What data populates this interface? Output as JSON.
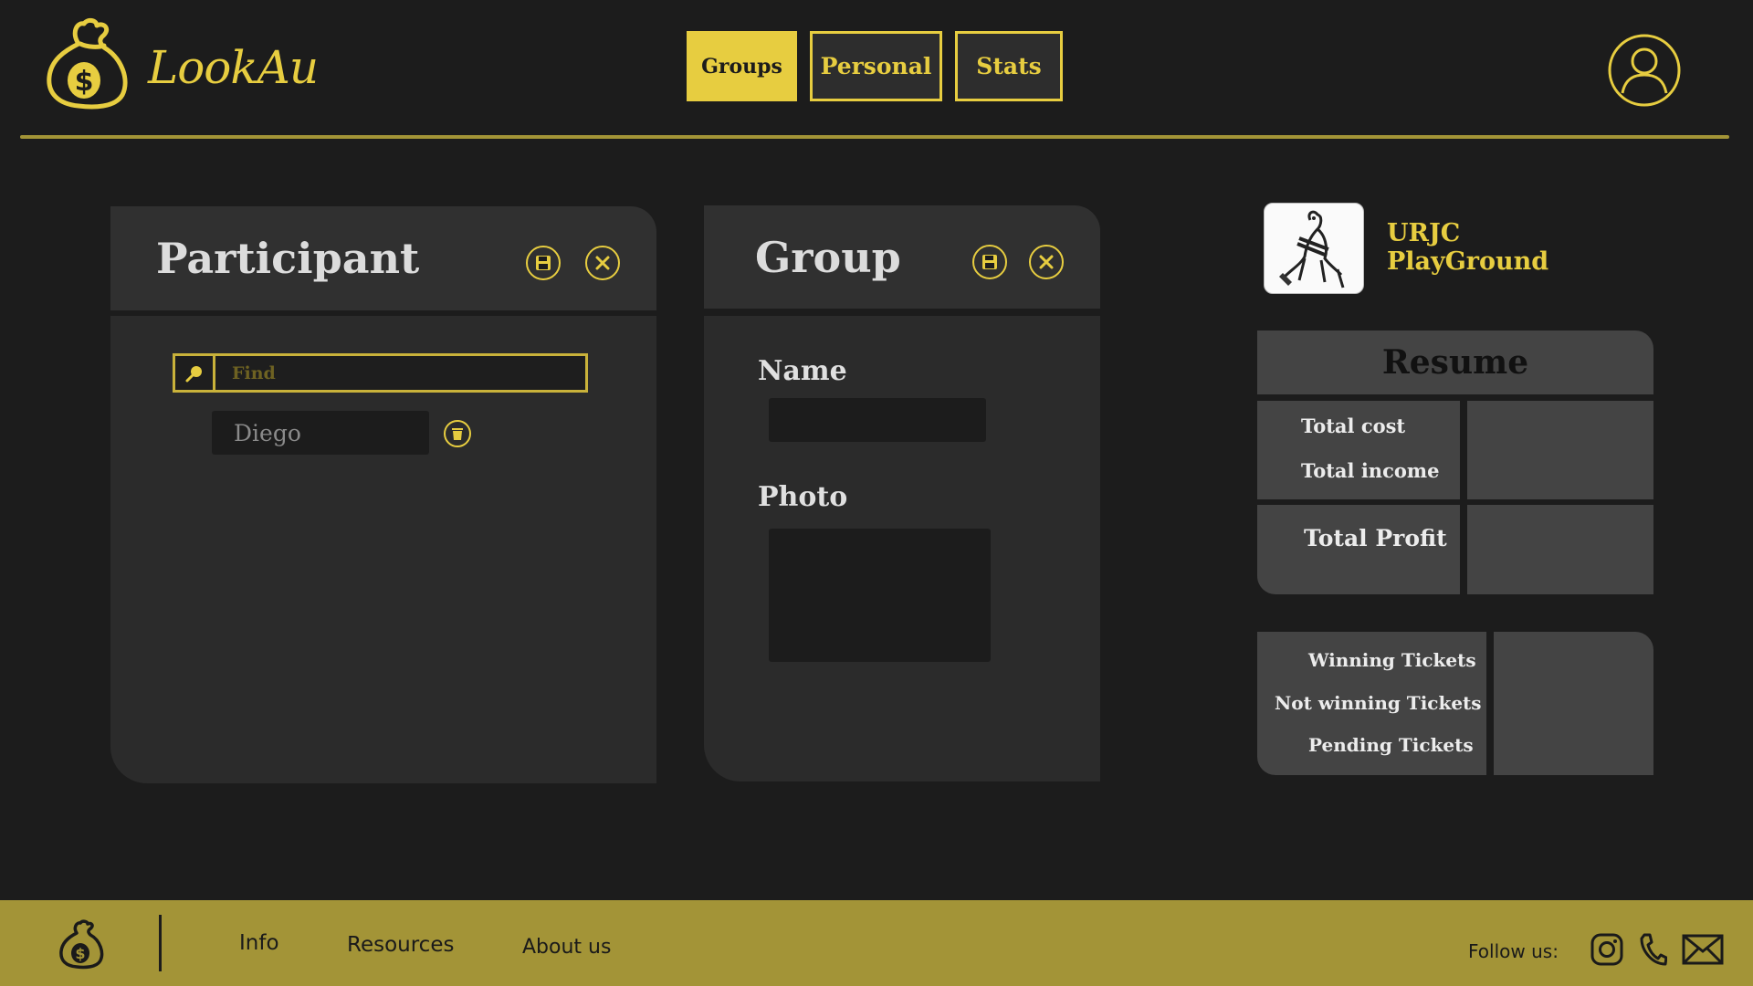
{
  "app": {
    "name": "LookAu"
  },
  "nav": {
    "groups": "Groups",
    "personal": "Personal",
    "stats": "Stats"
  },
  "participant": {
    "title": "Participant",
    "search_placeholder": "Find",
    "items": [
      "Diego"
    ]
  },
  "group": {
    "title": "Group",
    "name_label": "Name",
    "photo_label": "Photo"
  },
  "summary": {
    "group_name_line1": "URJC",
    "group_name_line2": "PlayGround",
    "resume_title": "Resume",
    "total_cost": "Total cost",
    "total_income": "Total income",
    "total_profit": "Total Profit",
    "winning_tickets": "Winning Tickets",
    "not_winning_tickets": "Not winning Tickets",
    "pending_tickets": "Pending Tickets"
  },
  "footer": {
    "info": "Info",
    "resources": "Resources",
    "about": "About us",
    "follow": "Follow  us:",
    "social_icons": [
      "instagram-icon",
      "phone-icon",
      "mail-icon"
    ]
  },
  "colors": {
    "accent": "#e7cd40",
    "footer": "#a39437",
    "background": "#1c1c1c",
    "panel": "#2b2b2b"
  }
}
